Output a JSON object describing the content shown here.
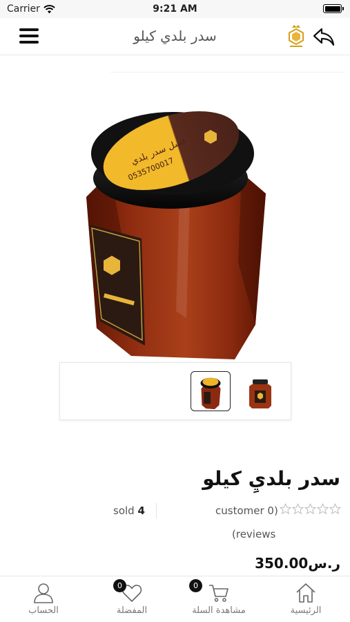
{
  "status_bar": {
    "carrier": "Carrier",
    "time": "9:21 AM"
  },
  "nav": {
    "title": "سدر بلدي كيلو",
    "logo_icon": "shop-logo-icon",
    "back_icon": "back-arrow-icon",
    "menu_icon": "hamburger-menu-icon"
  },
  "product": {
    "name": "سدر بلديِ كيلو",
    "sold_count": "4",
    "sold_label": "sold",
    "customers_text": "customer 0)",
    "reviews_text": "(reviews",
    "rating_stars": 0,
    "rating_max": 5,
    "price": "ر.س350.00",
    "jar_label_text": "عسل سدر بلدي",
    "jar_phone": "0535700017",
    "thumbnails": [
      {
        "name": "jar-front-thumb",
        "active": true
      },
      {
        "name": "jar-side-thumb",
        "active": false
      }
    ]
  },
  "tab_bar": {
    "home_label": "الرئيسية",
    "cart_label": "مشاهدة السلة",
    "cart_badge": "0",
    "favorites_label": "المفضلة",
    "favorites_badge": "0",
    "account_label": "الحساب"
  },
  "colors": {
    "honey": "#8a2a10",
    "lid": "#111111",
    "label_gold": "#f0b429",
    "label_brown": "#5a2a1e"
  }
}
